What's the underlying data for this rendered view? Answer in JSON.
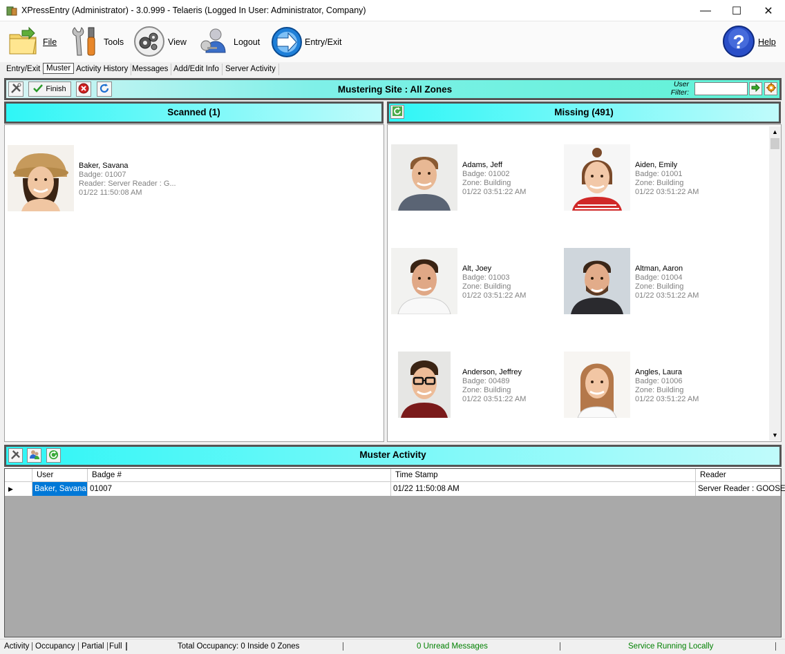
{
  "window": {
    "title": "XPressEntry (Administrator)  - 3.0.999 - Telaeris (Logged In User: Administrator, Company)",
    "minimize": "—",
    "maximize": "☐",
    "close": "✕"
  },
  "toolbar": {
    "file": "File",
    "tools": "Tools",
    "view": "View",
    "logout": "Logout",
    "entry_exit": "Entry/Exit",
    "help": "Help"
  },
  "tabs": [
    "Entry/Exit",
    "Muster",
    "Activity History",
    "Messages",
    "Add/Edit Info",
    "Server Activity"
  ],
  "muster": {
    "finish_label": "Finish",
    "title": "Mustering Site : All Zones",
    "user_filter_label": "User Filter:",
    "user_filter_value": ""
  },
  "scanned": {
    "header": "Scanned (1)",
    "people": [
      {
        "name": "Baker, Savana",
        "line1": "Badge: 01007",
        "line2": "Reader: Server Reader : G...",
        "line3": "01/22 11:50:08 AM"
      }
    ]
  },
  "missing": {
    "header": "Missing (491)",
    "people": [
      {
        "name": "Adams, Jeff",
        "line1": "Badge: 01002",
        "line2": "Zone: Building",
        "line3": "01/22 03:51:22 AM"
      },
      {
        "name": "Aiden, Emily",
        "line1": "Badge: 01001",
        "line2": "Zone: Building",
        "line3": "01/22 03:51:22 AM"
      },
      {
        "name": "Alt, Joey",
        "line1": "Badge: 01003",
        "line2": "Zone: Building",
        "line3": "01/22 03:51:22 AM"
      },
      {
        "name": "Altman, Aaron",
        "line1": "Badge: 01004",
        "line2": "Zone: Building",
        "line3": "01/22 03:51:22 AM"
      },
      {
        "name": "Anderson, Jeffrey",
        "line1": "Badge: 00489",
        "line2": "Zone: Building",
        "line3": "01/22 03:51:22 AM"
      },
      {
        "name": "Angles, Laura",
        "line1": "Badge: 01006",
        "line2": "Zone: Building",
        "line3": "01/22 03:51:22 AM"
      }
    ]
  },
  "activity": {
    "title": "Muster Activity",
    "columns": [
      "User",
      "Badge #",
      "Time Stamp",
      "Reader"
    ],
    "rows": [
      {
        "user": "Baker, Savana",
        "badge": "01007",
        "time": "01/22 11:50:08 AM",
        "reader": "Server Reader : GOOSE"
      }
    ]
  },
  "status": {
    "tabs": [
      "Activity",
      "Occupancy",
      "Partial",
      "Full"
    ],
    "occupancy": "Total Occupancy: 0 Inside 0 Zones",
    "messages": "0 Unread Messages",
    "service": "Service Running Locally"
  },
  "colors": {
    "accent_cyan": "#2ef6f6",
    "muster_green": "#5ff2d6",
    "selected_cell": "#0078d7",
    "status_green": "#008000"
  }
}
